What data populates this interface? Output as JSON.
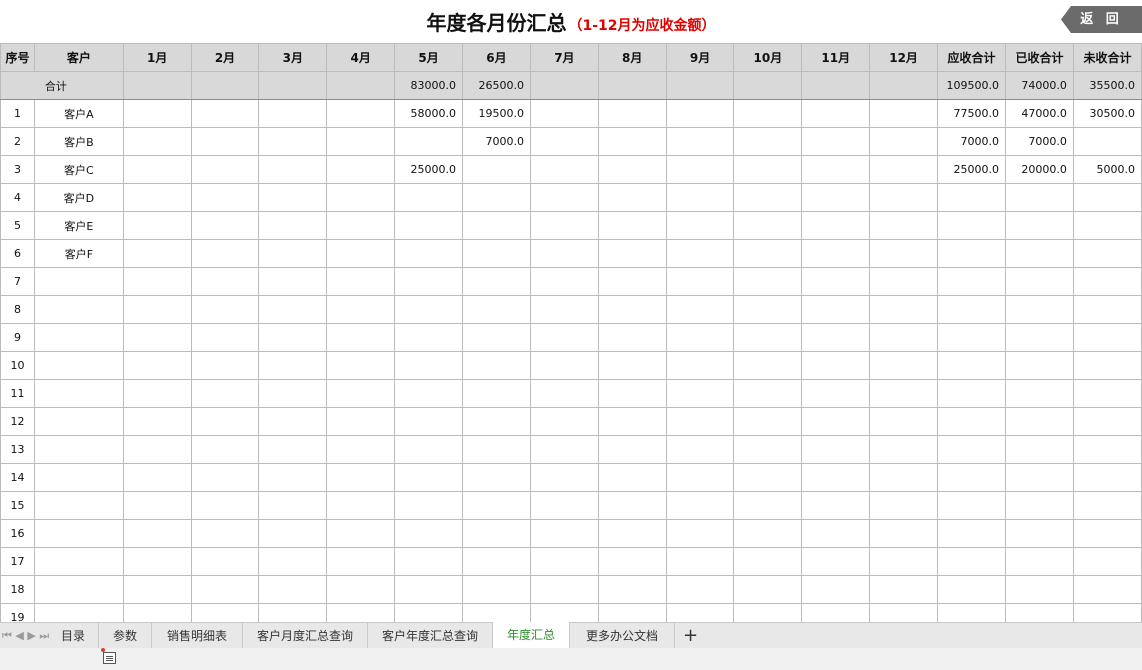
{
  "title": {
    "main": "年度各月份汇总",
    "sub": "（1-12月为应收金额）"
  },
  "back_button": "返 回",
  "columns": [
    "序号",
    "客户",
    "1月",
    "2月",
    "3月",
    "4月",
    "5月",
    "6月",
    "7月",
    "8月",
    "9月",
    "10月",
    "11月",
    "12月",
    "应收合计",
    "已收合计",
    "未收合计"
  ],
  "total_row": {
    "label": "合计",
    "m5": "83000.0",
    "m6": "26500.0",
    "receivable": "109500.0",
    "received": "74000.0",
    "outstanding": "35500.0"
  },
  "rows": [
    {
      "seq": "1",
      "customer": "客户A",
      "m5": "58000.0",
      "m6": "19500.0",
      "receivable": "77500.0",
      "received": "47000.0",
      "outstanding": "30500.0"
    },
    {
      "seq": "2",
      "customer": "客户B",
      "m5": "",
      "m6": "7000.0",
      "receivable": "7000.0",
      "received": "7000.0",
      "outstanding": ""
    },
    {
      "seq": "3",
      "customer": "客户C",
      "m5": "25000.0",
      "m6": "",
      "receivable": "25000.0",
      "received": "20000.0",
      "outstanding": "5000.0"
    },
    {
      "seq": "4",
      "customer": "客户D"
    },
    {
      "seq": "5",
      "customer": "客户E"
    },
    {
      "seq": "6",
      "customer": "客户F"
    },
    {
      "seq": "7",
      "customer": ""
    },
    {
      "seq": "8",
      "customer": ""
    },
    {
      "seq": "9",
      "customer": ""
    },
    {
      "seq": "10",
      "customer": ""
    },
    {
      "seq": "11",
      "customer": ""
    },
    {
      "seq": "12",
      "customer": ""
    },
    {
      "seq": "13",
      "customer": ""
    },
    {
      "seq": "14",
      "customer": ""
    },
    {
      "seq": "15",
      "customer": ""
    },
    {
      "seq": "16",
      "customer": ""
    },
    {
      "seq": "17",
      "customer": ""
    },
    {
      "seq": "18",
      "customer": ""
    },
    {
      "seq": "19",
      "customer": ""
    }
  ],
  "sheet_tabs": [
    "目录",
    "参数",
    "销售明细表",
    "客户月度汇总查询",
    "客户年度汇总查询",
    "年度汇总",
    "更多办公文档"
  ],
  "active_tab": "年度汇总",
  "add_tab_label": "+",
  "nav_arrows": "⏮ ◀ ▶ ⏭",
  "colors": {
    "tab_active": "#2e8b2e",
    "subtitle": "#e00000",
    "header_bg": "#d8d8d8",
    "back_button_bg": "#6b6b6b"
  }
}
